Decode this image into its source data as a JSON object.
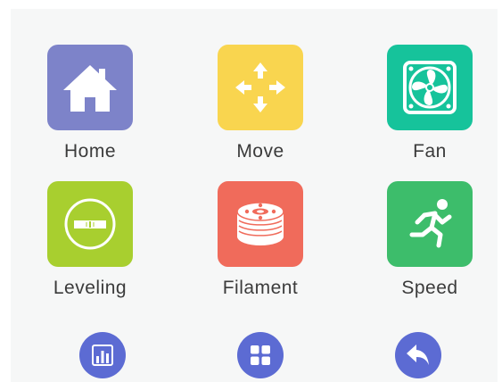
{
  "menu": {
    "items": [
      {
        "label": "Home",
        "icon": "house-icon",
        "color": "#7d83c9"
      },
      {
        "label": "Move",
        "icon": "move-arrows-icon",
        "color": "#f9d54f"
      },
      {
        "label": "Fan",
        "icon": "fan-icon",
        "color": "#16c39b"
      },
      {
        "label": "Leveling",
        "icon": "spirit-level-icon",
        "color": "#a8cf2f"
      },
      {
        "label": "Filament",
        "icon": "filament-spool-icon",
        "color": "#f06b5b"
      },
      {
        "label": "Speed",
        "icon": "running-person-icon",
        "color": "#3dbd6b"
      }
    ]
  },
  "bottom_bar": {
    "buttons": [
      {
        "icon": "bar-chart-icon",
        "color": "#5c6bd3"
      },
      {
        "icon": "grid-menu-icon",
        "color": "#5c6bd3"
      },
      {
        "icon": "back-arrow-icon",
        "color": "#5c6bd3"
      }
    ]
  }
}
